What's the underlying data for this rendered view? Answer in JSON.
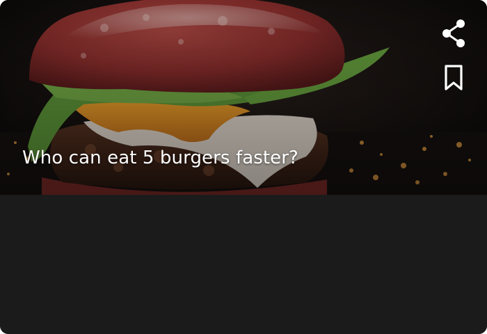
{
  "card": {
    "title": "Who can eat 5 burgers faster?",
    "image": {
      "subject": "burger-photo"
    },
    "actions": {
      "share_icon": "share-icon",
      "bookmark_icon": "bookmark-icon"
    }
  },
  "colors": {
    "background": "#1b1b1b",
    "title_text": "#ffffff",
    "icon": "#ffffff"
  }
}
